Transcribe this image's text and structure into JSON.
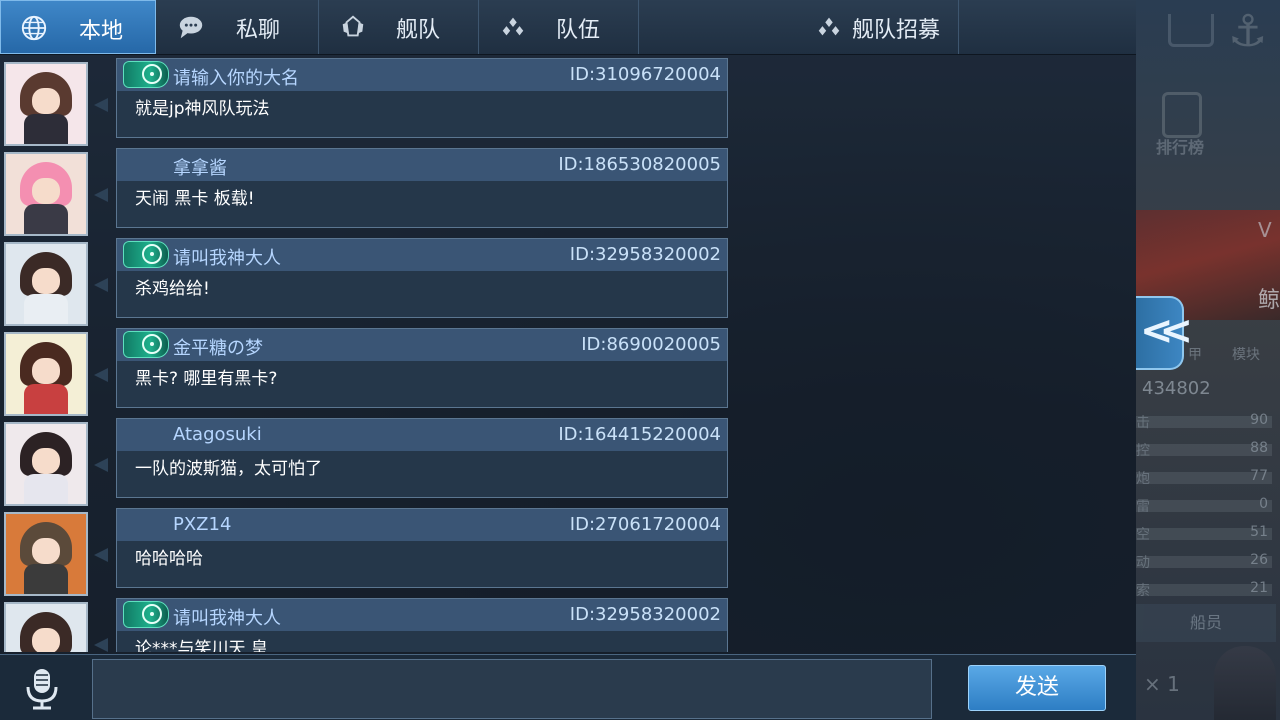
{
  "tabs": [
    {
      "label": "本地",
      "icon": "globe-icon",
      "active": true
    },
    {
      "label": "私聊",
      "icon": "chat-bubble-icon",
      "active": false
    },
    {
      "label": "舰队",
      "icon": "fleet-emblem-icon",
      "active": false
    },
    {
      "label": "队伍",
      "icon": "team-icon",
      "active": false
    },
    {
      "label": "舰队招募",
      "icon": "team-icon",
      "active": false
    }
  ],
  "messages": [
    {
      "name": "请输入你的大名",
      "id": "ID:31096720004",
      "text": "就是jp神风队玩法",
      "has_badge": true
    },
    {
      "name": "拿拿酱",
      "id": "ID:186530820005",
      "text": "天闹 黑卡 板载!",
      "has_badge": false
    },
    {
      "name": "请叫我神大人",
      "id": "ID:32958320002",
      "text": "杀鸡给给!",
      "has_badge": true
    },
    {
      "name": "金平糖の梦",
      "id": "ID:8690020005",
      "text": "黑卡? 哪里有黑卡?",
      "has_badge": true
    },
    {
      "name": "Atagosuki",
      "id": "ID:164415220004",
      "text": "一队的波斯猫，太可怕了",
      "has_badge": false
    },
    {
      "name": "PXZ14",
      "id": "ID:27061720004",
      "text": "哈哈哈哈",
      "has_badge": false
    },
    {
      "name": "请叫我神大人",
      "id": "ID:32958320002",
      "text": "论***与笑川天 皇",
      "has_badge": true
    }
  ],
  "input": {
    "value": "",
    "placeholder": ""
  },
  "send_label": "发送",
  "side_panel": {
    "rank_label": "排行榜",
    "v_label": "V",
    "ship_char": "鲸",
    "small_a": "甲",
    "small_b": "模块",
    "number": "434802",
    "stats": [
      {
        "label": "击",
        "value": "90"
      },
      {
        "label": "控",
        "value": "88"
      },
      {
        "label": "炮",
        "value": "77"
      },
      {
        "label": "雷",
        "value": "0"
      },
      {
        "label": "空",
        "value": "51"
      },
      {
        "label": "动",
        "value": "26"
      },
      {
        "label": "索",
        "value": "21"
      }
    ],
    "crew_label": "船员",
    "count_label": "× 1"
  },
  "colors": {
    "tab_active": "#2f78bb",
    "bubble_header": "#3a5575",
    "name_text": "#b6d6ff",
    "send_button": "#3d8fd4",
    "badge": "#1eb08c"
  }
}
